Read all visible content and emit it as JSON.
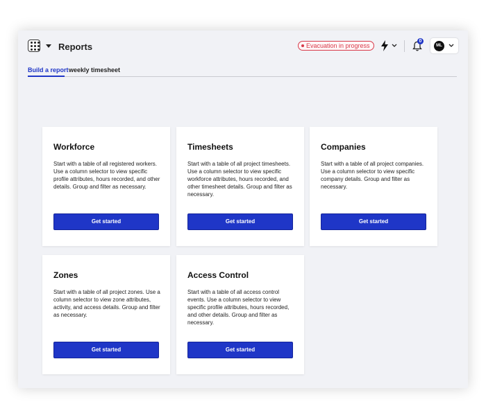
{
  "header": {
    "title": "Reports",
    "evacuation_label": "Evacuation in progress",
    "notification_count": "0",
    "user_initials": "ML"
  },
  "tabs": [
    {
      "label": "Build a report",
      "active": true
    },
    {
      "label": "weekly timesheet",
      "active": false
    }
  ],
  "cards": [
    {
      "title": "Workforce",
      "description": "Start with a table of all registered workers. Use a column selector to view specific profile attributes, hours recorded, and other details. Group and filter as necessary.",
      "button_label": "Get started"
    },
    {
      "title": "Timesheets",
      "description": "Start with a table of all project timesheets. Use a column selector to view specific workforce attributes, hours recorded, and other timesheet details. Group and filter as necessary.",
      "button_label": "Get started"
    },
    {
      "title": "Companies",
      "description": "Start with a table of all project companies. Use a column selector to view specific company details. Group and filter as necessary.",
      "button_label": "Get started"
    },
    {
      "title": "Zones",
      "description": "Start with a table of all project zones. Use a column selector to view zone attributes, activity, and access details. Group and filter as necessary.",
      "button_label": "Get started"
    },
    {
      "title": "Access Control",
      "description": "Start with a table of all access control events. Use a column selector to view specific profile attributes, hours recorded, and other details. Group and filter as necessary.",
      "button_label": "Get started"
    }
  ],
  "icons": {
    "apps": "grid-dots-icon",
    "menu_caret": "caret-down-icon",
    "quick_actions": "lightning-bolt-icon",
    "notifications": "bell-icon",
    "user_menu": "chevron-down-icon"
  },
  "colors": {
    "accent": "#1f36c7",
    "alert": "#d83a4a",
    "background": "#f1f2f6"
  }
}
